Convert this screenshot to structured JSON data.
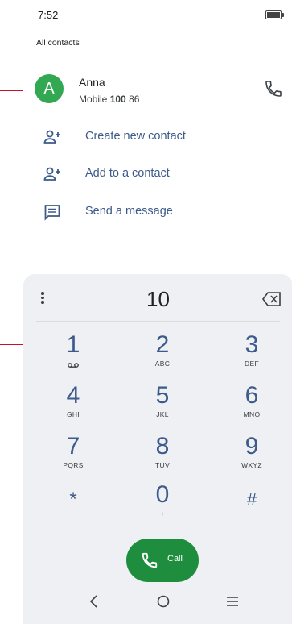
{
  "status_bar": {
    "time": "7:52"
  },
  "list": {
    "section_title": "All contacts",
    "contact": {
      "avatar_letter": "A",
      "name": "Anna",
      "type": "Mobile",
      "number_match": "100",
      "number_rest": " 86"
    },
    "actions": [
      {
        "label": "Create new contact",
        "icon": "add-person-icon"
      },
      {
        "label": "Add to a contact",
        "icon": "add-person-icon"
      },
      {
        "label": "Send a message",
        "icon": "message-icon"
      }
    ]
  },
  "dialpad": {
    "entered_digits": "10",
    "keys": [
      {
        "num": "1",
        "letters": ""
      },
      {
        "num": "2",
        "letters": "ABC"
      },
      {
        "num": "3",
        "letters": "DEF"
      },
      {
        "num": "4",
        "letters": "GHI"
      },
      {
        "num": "5",
        "letters": "JKL"
      },
      {
        "num": "6",
        "letters": "MNO"
      },
      {
        "num": "7",
        "letters": "PQRS"
      },
      {
        "num": "8",
        "letters": "TUV"
      },
      {
        "num": "9",
        "letters": "WXYZ"
      },
      {
        "num": "*",
        "letters": ""
      },
      {
        "num": "0",
        "letters": "+"
      },
      {
        "num": "#",
        "letters": ""
      }
    ],
    "call_label": "Call"
  },
  "colors": {
    "accent_green": "#1e8e3e",
    "avatar_green": "#33a852",
    "key_blue": "#3c5a8a",
    "callout_red": "#c8102e"
  }
}
